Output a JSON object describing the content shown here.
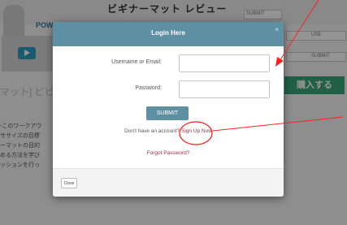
{
  "background_page": {
    "title": "ビギナーマット レビュー",
    "logo_text": "POW",
    "review_heading": "マット] ビビュー",
    "cta_label": "購入する",
    "field_labels": [
      "SUBMIT",
      "USE",
      "SUBMIT"
    ],
    "paragraph_lines": [
      "-このワークアウ",
      "ササイズの目標",
      "ーマットの目的",
      "める方法を学び",
      "ッションを行っ"
    ]
  },
  "modal": {
    "title": "Login Here",
    "close_symbol": "×",
    "username_label": "Username or Email:",
    "username_value": "",
    "password_label": "Password:",
    "password_value": "",
    "submit_label": "SUBMIT",
    "no_account_text": "Don't have an account?",
    "signup_link": "Sign Up Now",
    "forgot_password": "Forgot Password?",
    "close_button": "Close"
  },
  "annotations": {
    "color": "#ff2020",
    "highlight": "circle around Sign Up Now link",
    "arrows": 2
  },
  "colors": {
    "header": "#5f8fa3",
    "link": "#9b2d4a",
    "annotation": "#ff2020"
  }
}
